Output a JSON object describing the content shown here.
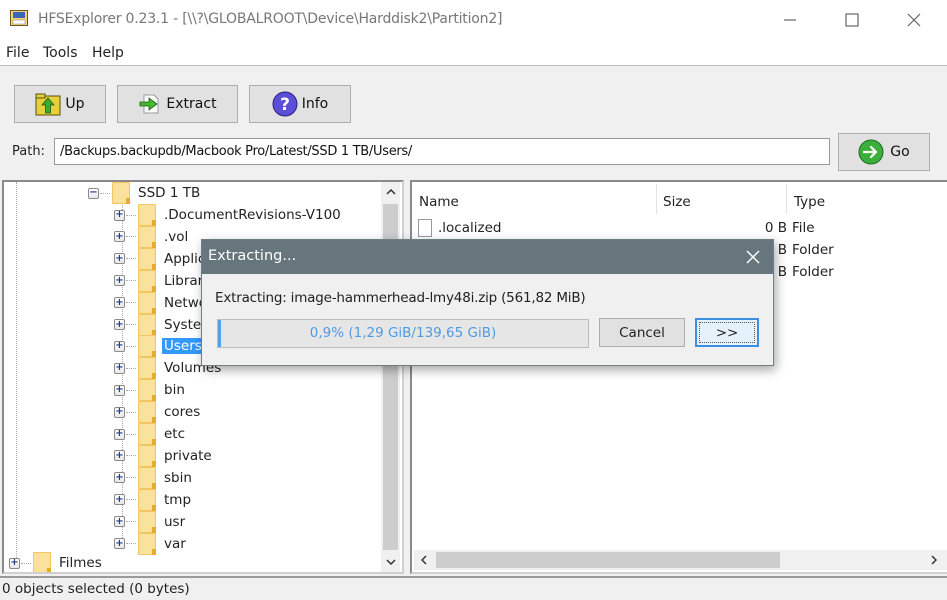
{
  "window": {
    "title": "HFSExplorer 0.23.1 - [\\\\?\\GLOBALROOT\\Device\\Harddisk2\\Partition2]",
    "icon": "hfsexplorer-app-icon",
    "controls": {
      "minimize": "minimize-icon",
      "maximize": "maximize-icon",
      "close": "close-icon"
    }
  },
  "menu": {
    "items": [
      {
        "label": "File"
      },
      {
        "label": "Tools"
      },
      {
        "label": "Help"
      }
    ]
  },
  "toolbar": {
    "up_label": "Up",
    "up_icon": "folder-up-icon",
    "extract_label": "Extract",
    "extract_icon": "extract-arrow-icon",
    "info_label": "Info",
    "info_icon": "question-icon"
  },
  "path": {
    "label": "Path:",
    "value": "/Backups.backupdb/Macbook Pro/Latest/SSD 1 TB/Users/",
    "go_label": "Go",
    "go_icon": "go-arrow-icon"
  },
  "tree": {
    "parent": {
      "label": "SSD 1 TB",
      "expanded": true
    },
    "children": [
      {
        "label": ".DocumentRevisions-V100"
      },
      {
        "label": ".vol"
      },
      {
        "label": "Applications"
      },
      {
        "label": "Library"
      },
      {
        "label": "Network"
      },
      {
        "label": "System"
      },
      {
        "label": "Users",
        "selected": true
      },
      {
        "label": "Volumes"
      },
      {
        "label": "bin"
      },
      {
        "label": "cores"
      },
      {
        "label": "etc"
      },
      {
        "label": "private"
      },
      {
        "label": "sbin"
      },
      {
        "label": "tmp"
      },
      {
        "label": "usr"
      },
      {
        "label": "var"
      }
    ],
    "sibling": {
      "label": "Filmes"
    }
  },
  "file_list": {
    "columns": [
      "Name",
      "Size",
      "Type"
    ],
    "rows": [
      {
        "name": ".localized",
        "size": "0 B",
        "type": "File"
      },
      {
        "name": "",
        "size": "0 B",
        "type": "Folder"
      },
      {
        "name": "",
        "size": "0 B",
        "type": "Folder"
      }
    ]
  },
  "status": {
    "text": "0 objects selected (0 bytes)"
  },
  "dialog": {
    "title": "Extracting...",
    "message": "Extracting: image-hammerhead-lmy48i.zip (561,82 MiB)",
    "progress_percent": 0.9,
    "progress_text": "0,9% (1,29 GiB/139,65 GiB)",
    "cancel_label": "Cancel",
    "more_label": ">>"
  }
}
